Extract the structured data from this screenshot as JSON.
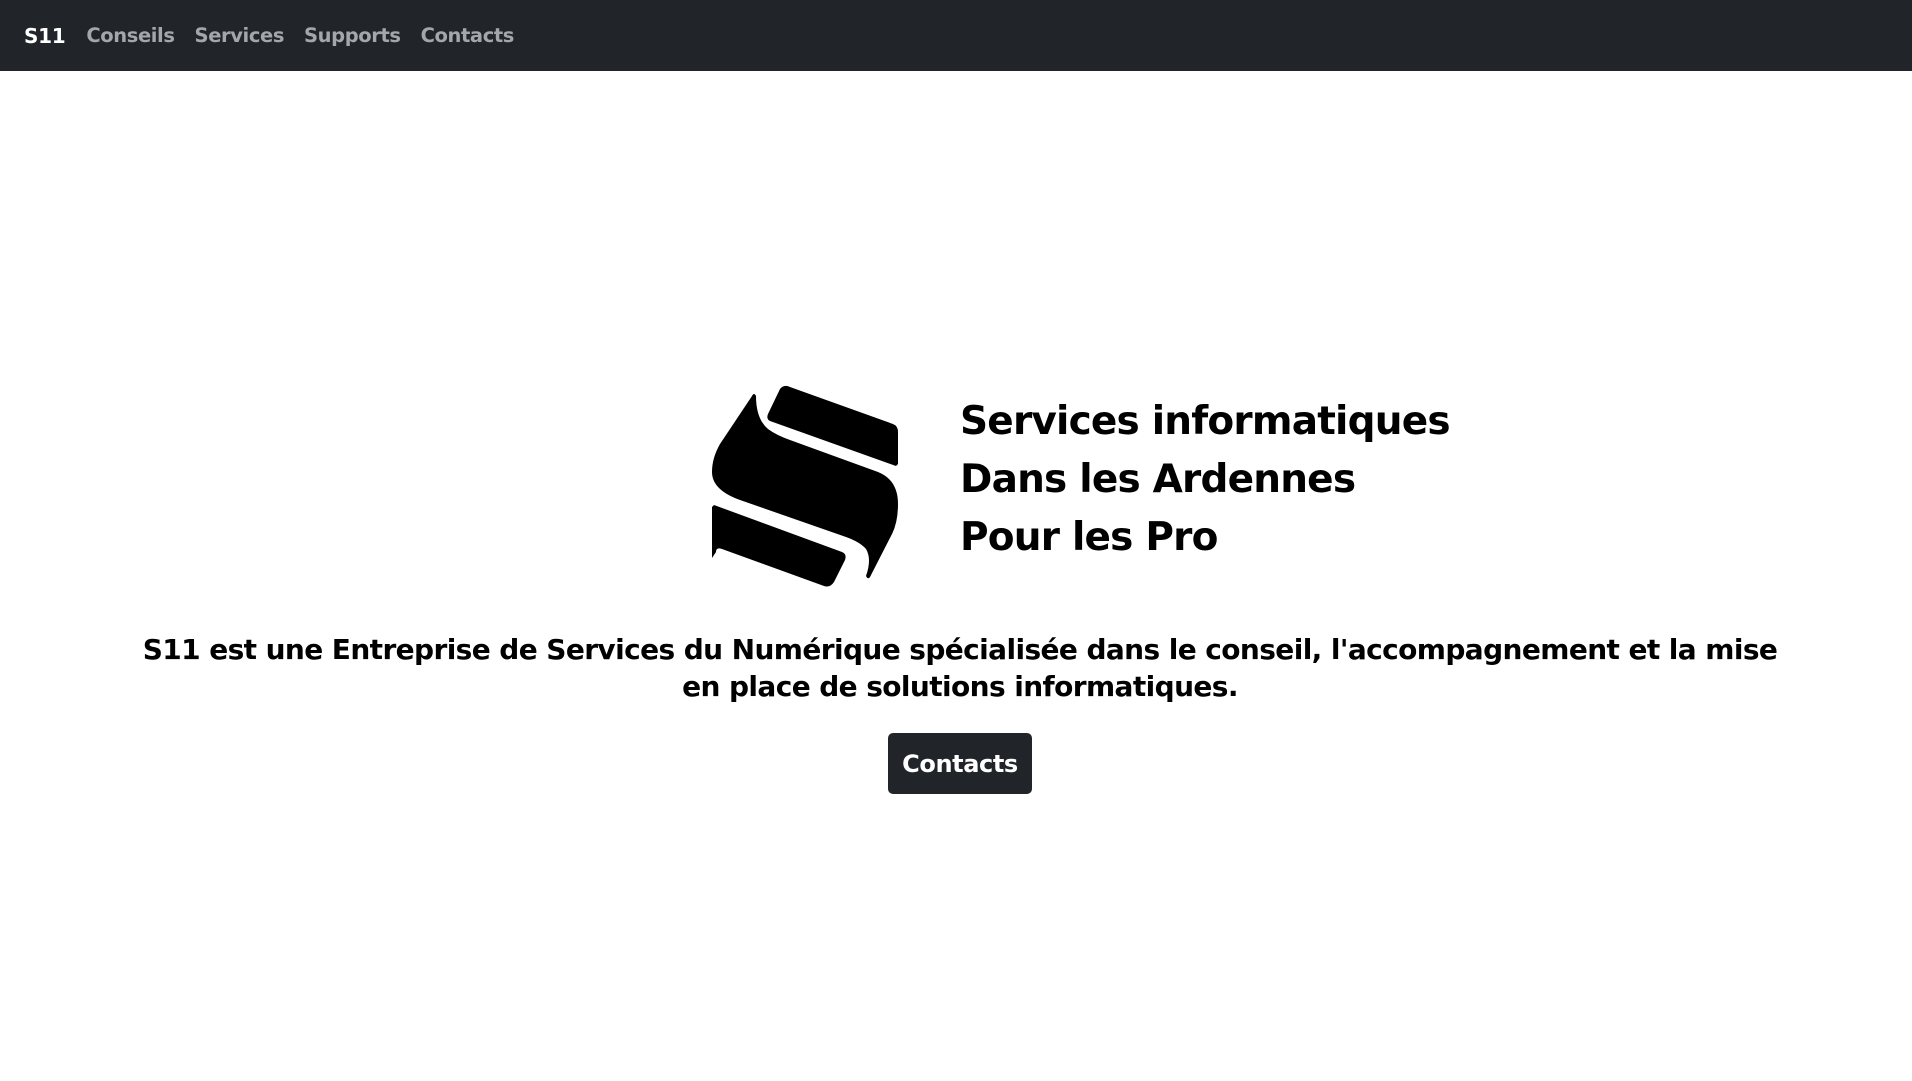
{
  "navbar": {
    "brand": "S11",
    "links": [
      "Conseils",
      "Services",
      "Supports",
      "Contacts"
    ],
    "background": "#212529"
  },
  "hero": {
    "logo_icon": "s11-logo",
    "taglines": [
      "Services informatiques",
      "Dans les Ardennes",
      "Pour les Pro"
    ],
    "description": "S11 est une Entreprise de Services du Numérique spécialisée dans le conseil, l'accompagnement et la mise en place de solutions informatiques.",
    "cta_label": "Contacts"
  }
}
